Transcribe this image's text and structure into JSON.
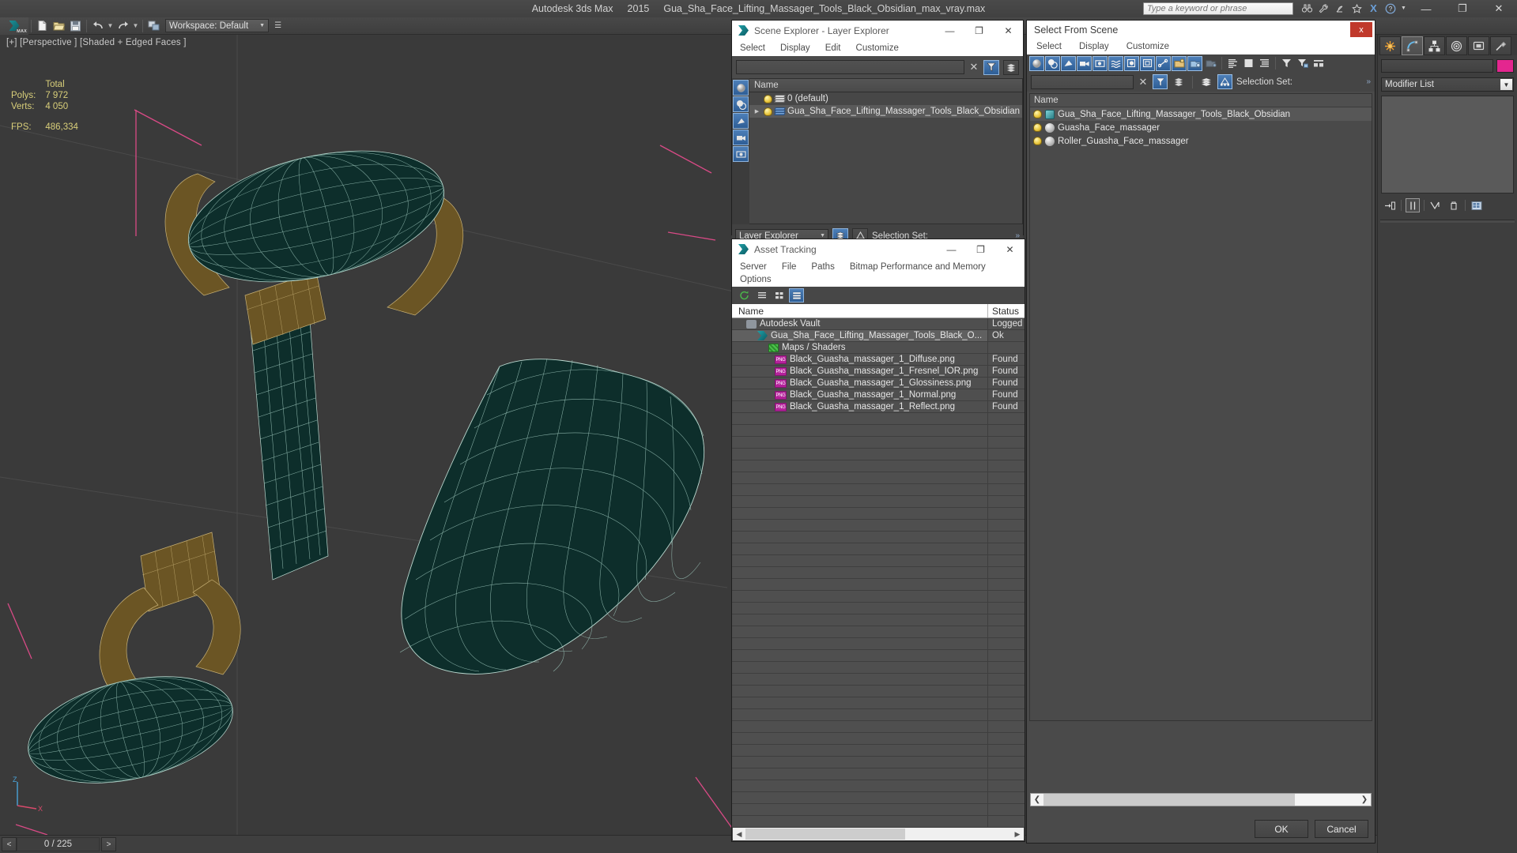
{
  "titlebar": {
    "app_name": "Autodesk 3ds Max",
    "version": "2015",
    "file_name": "Gua_Sha_Face_Lifting_Massager_Tools_Black_Obsidian_max_vray.max",
    "search_placeholder": "Type a keyword or phrase",
    "minimize": "—",
    "maximize": "❐",
    "close": "✕",
    "icons": [
      "binoculars-icon",
      "wrench-icon",
      "satellite-icon",
      "star-icon",
      "exchange-icon",
      "help-icon",
      "caret-down-icon"
    ]
  },
  "maintoolbar": {
    "workspace_label": "Workspace: Default",
    "buttons": [
      "new-file",
      "open-file",
      "save-file",
      "undo",
      "undo-dropdown",
      "redo",
      "redo-dropdown",
      "select-link"
    ]
  },
  "viewport": {
    "label": "[+] [Perspective ] [Shaded + Edged Faces ]",
    "stats": {
      "total_header": "Total",
      "polys_label": "Polys:",
      "polys_value": "7 972",
      "verts_label": "Verts:",
      "verts_value": "4 050",
      "fps_label": "FPS:",
      "fps_value": "486,334"
    },
    "axis": {
      "z": "Z",
      "x": "X"
    }
  },
  "scene_explorer": {
    "window_title": "Scene Explorer - Layer Explorer",
    "menu": [
      "Select",
      "Display",
      "Edit",
      "Customize"
    ],
    "column_name": "Name",
    "rows": [
      {
        "label": "0 (default)",
        "indent": 1,
        "selected": false,
        "expandable": false,
        "stack_color": "white"
      },
      {
        "label": "Gua_Sha_Face_Lifting_Massager_Tools_Black_Obsidian",
        "indent": 0,
        "selected": true,
        "expandable": true,
        "stack_color": "blue"
      }
    ],
    "footer": {
      "combo_value": "Layer Explorer",
      "selection_set_label": "Selection Set:"
    },
    "minimize": "—",
    "maximize": "❐",
    "close": "✕"
  },
  "asset_tracking": {
    "window_title": "Asset Tracking",
    "menu": [
      "Server",
      "File",
      "Paths",
      "Bitmap Performance and Memory",
      "Options"
    ],
    "columns": {
      "name": "Name",
      "status": "Status"
    },
    "rows": [
      {
        "name": "Autodesk Vault",
        "status": "Logged",
        "icon": "vault-icon",
        "indent": 1,
        "selected": false
      },
      {
        "name": "Gua_Sha_Face_Lifting_Massager_Tools_Black_O...",
        "status": "Ok",
        "icon": "max-file-icon",
        "indent": 2,
        "selected": true
      },
      {
        "name": "Maps / Shaders",
        "status": "",
        "icon": "maps-shaders-icon",
        "indent": 3,
        "selected": false
      },
      {
        "name": "Black_Guasha_massager_1_Diffuse.png",
        "status": "Found",
        "icon": "png-icon",
        "indent": 4,
        "selected": false
      },
      {
        "name": "Black_Guasha_massager_1_Fresnel_IOR.png",
        "status": "Found",
        "icon": "png-icon",
        "indent": 4,
        "selected": false
      },
      {
        "name": "Black_Guasha_massager_1_Glossiness.png",
        "status": "Found",
        "icon": "png-icon",
        "indent": 4,
        "selected": false
      },
      {
        "name": "Black_Guasha_massager_1_Normal.png",
        "status": "Found",
        "icon": "png-icon",
        "indent": 4,
        "selected": false
      },
      {
        "name": "Black_Guasha_massager_1_Reflect.png",
        "status": "Found",
        "icon": "png-icon",
        "indent": 4,
        "selected": false
      }
    ],
    "minimize": "—",
    "maximize": "❐",
    "close": "✕"
  },
  "select_from_scene": {
    "window_title": "Select From Scene",
    "close_label": "x",
    "menu": [
      "Select",
      "Display",
      "Customize"
    ],
    "selection_set_label": "Selection Set:",
    "column_name": "Name",
    "rows": [
      {
        "label": "Gua_Sha_Face_Lifting_Massager_Tools_Black_Obsidian",
        "type": "group",
        "selected": true
      },
      {
        "label": "Guasha_Face_massager",
        "type": "object",
        "selected": false
      },
      {
        "label": "Roller_Guasha_Face_massager",
        "type": "object",
        "selected": false
      }
    ],
    "ok_label": "OK",
    "cancel_label": "Cancel"
  },
  "command_panel": {
    "tabs": [
      "create-tab",
      "modify-tab",
      "hierarchy-tab",
      "motion-tab",
      "display-tab",
      "utilities-tab"
    ],
    "active_tab_index": 1,
    "object_name": "",
    "object_color": "#e4268f",
    "modifier_list_label": "Modifier List",
    "stack_buttons": [
      "pin-stack",
      "show-end-result",
      "make-unique",
      "remove-modifier",
      "configure-modifier-sets"
    ]
  },
  "statusbar": {
    "prev_frame": "<",
    "frame_indicator": "0 / 225",
    "next_frame": ">"
  }
}
